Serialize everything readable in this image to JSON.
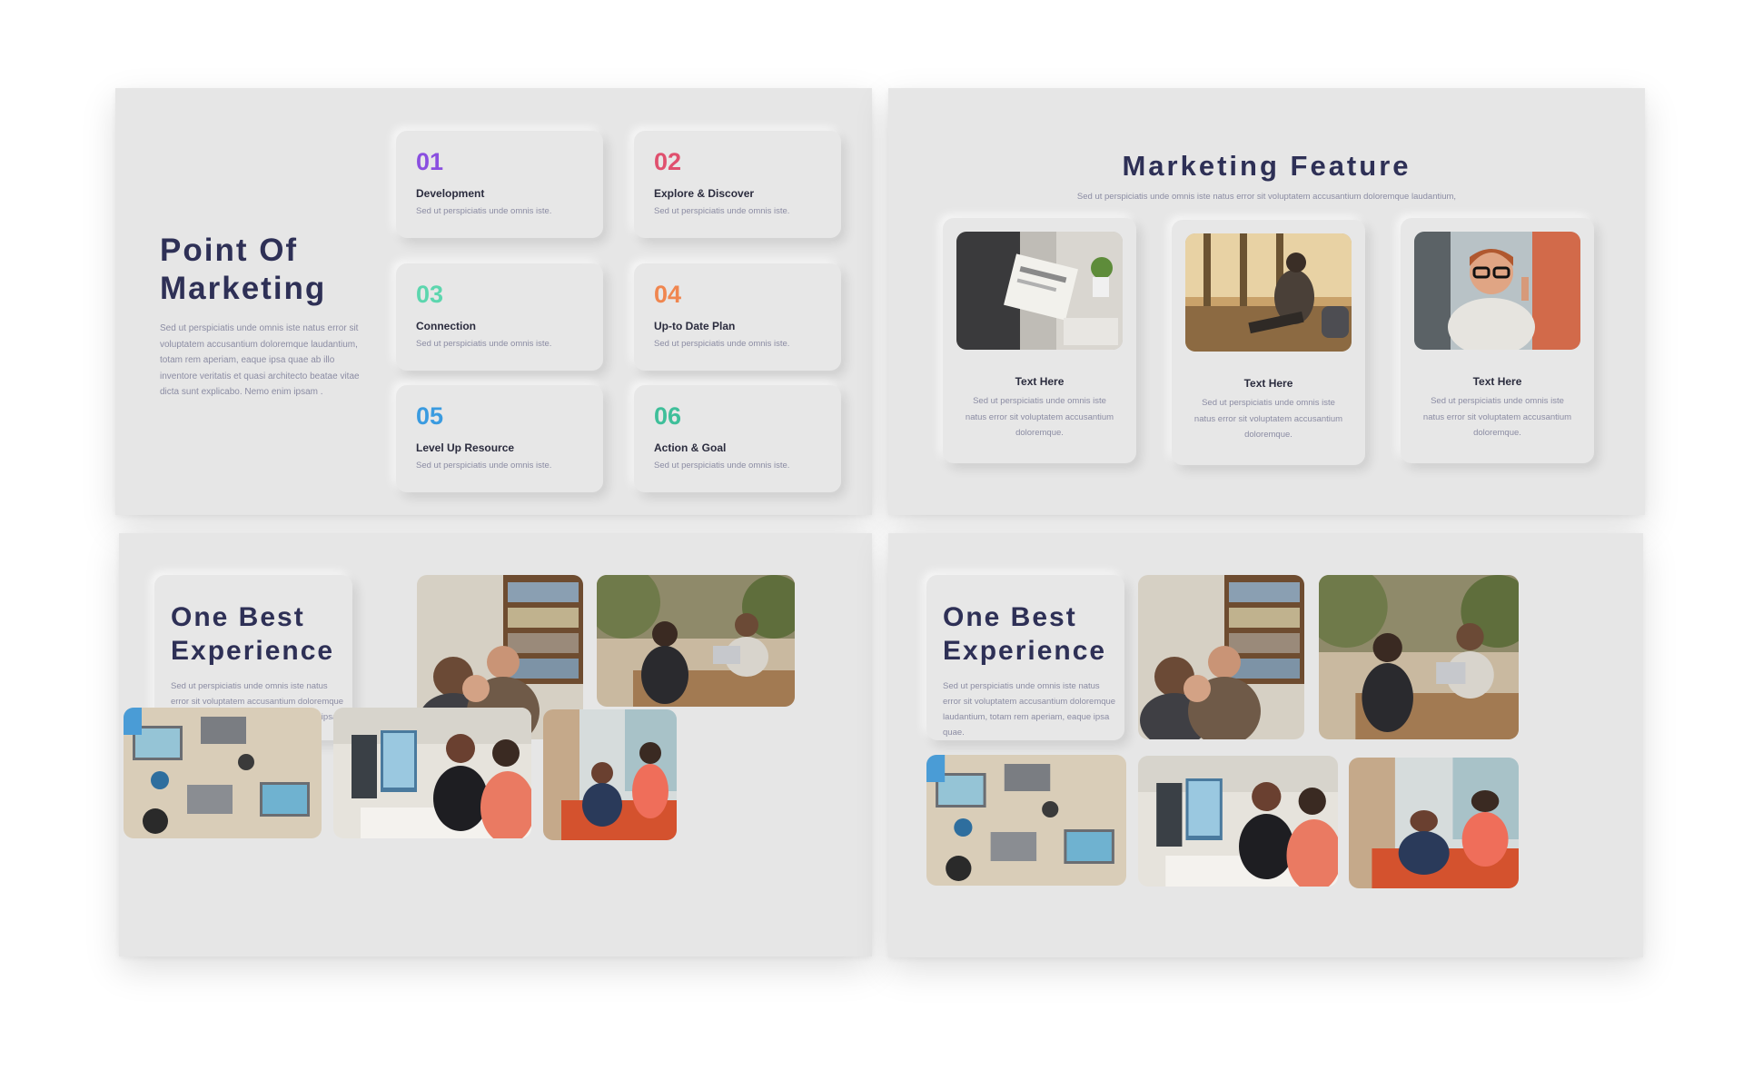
{
  "slide1": {
    "title": "Point Of\nMarketing",
    "body": "Sed ut perspiciatis unde omnis iste natus error sit voluptatem accusantium doloremque laudantium, totam rem aperiam, eaque ipsa quae ab illo inventore veritatis et quasi architecto beatae vitae dicta sunt explicabo. Nemo enim ipsam .",
    "features": [
      {
        "num": "01",
        "label": "Development",
        "desc": "Sed ut perspiciatis unde omnis iste.",
        "color": "#8a4fe0"
      },
      {
        "num": "02",
        "label": "Explore & Discover",
        "desc": "Sed ut perspiciatis unde omnis iste.",
        "color": "#e0506e"
      },
      {
        "num": "03",
        "label": "Connection",
        "desc": "Sed ut perspiciatis unde omnis iste.",
        "color": "#5cd6ae"
      },
      {
        "num": "04",
        "label": "Up-to Date Plan",
        "desc": "Sed ut perspiciatis unde omnis iste.",
        "color": "#f0864f"
      },
      {
        "num": "05",
        "label": "Level Up Resource",
        "desc": "Sed ut perspiciatis unde omnis iste.",
        "color": "#3a9be0"
      },
      {
        "num": "06",
        "label": "Action & Goal",
        "desc": "Sed ut perspiciatis unde omnis iste.",
        "color": "#3fbf9a"
      }
    ]
  },
  "slide2": {
    "title": "Marketing Feature",
    "subtitle": "Sed ut perspiciatis unde omnis iste natus error sit voluptatem accusantium doloremque laudantium,",
    "cards": [
      {
        "title": "Text Here",
        "desc": "Sed ut perspiciatis unde omnis iste natus error sit voluptatem accusantium doloremque."
      },
      {
        "title": "Text Here",
        "desc": "Sed ut perspiciatis unde omnis iste natus error sit voluptatem accusantium doloremque."
      },
      {
        "title": "Text Here",
        "desc": "Sed ut perspiciatis unde omnis iste natus error sit voluptatem accusantium doloremque."
      }
    ]
  },
  "slide3": {
    "title": "One Best\nExperience",
    "body": "Sed ut perspiciatis unde omnis iste natus error sit voluptatem accusantium doloremque laudantium, totam rem aperiam, eaque ipsa quae."
  },
  "slide4": {
    "title": "One Best\nExperience",
    "body": "Sed ut perspiciatis unde omnis iste natus error sit voluptatem accusantium doloremque laudantium, totam rem aperiam, eaque ipsa quae."
  },
  "colors": {
    "background": "#ffffff",
    "slide": "#e6e6e6",
    "heading": "#2e3056",
    "body_text": "#8b8ca3"
  }
}
